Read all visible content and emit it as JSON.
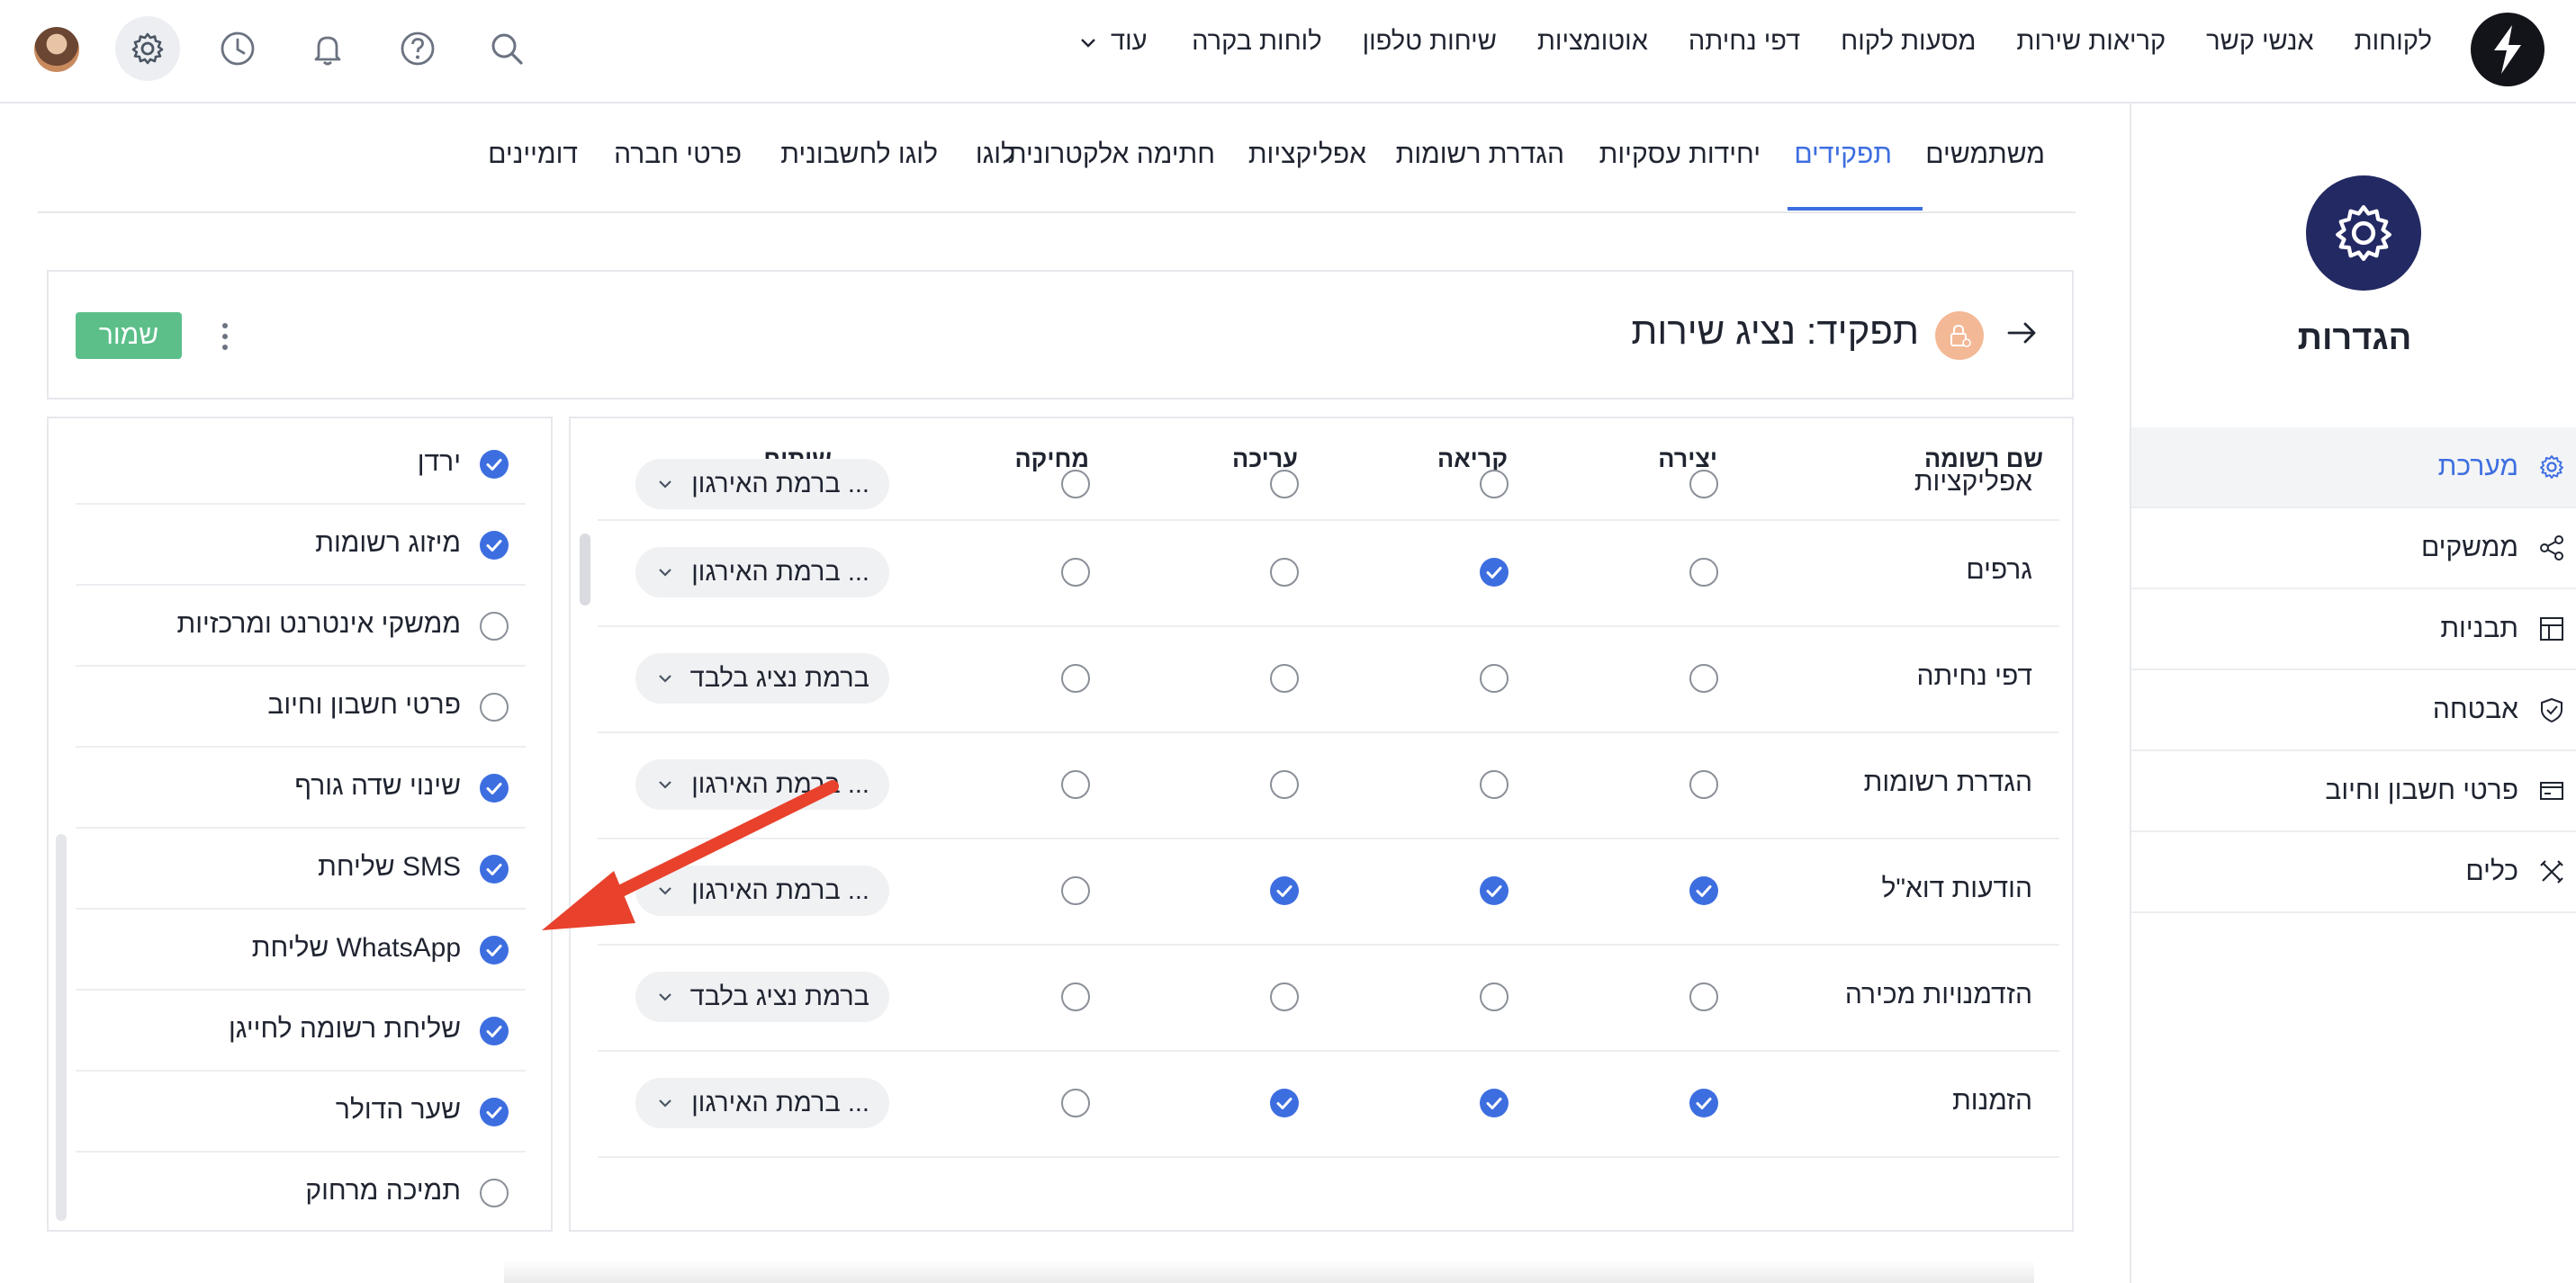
{
  "topbar": {
    "nav": [
      "לקוחות",
      "אנשי קשר",
      "קריאות שירות",
      "מסעות לקוח",
      "דפי נחיתה",
      "אוטומציות",
      "שיחות טלפון",
      "לוחות בקרה"
    ],
    "more_label": "עוד",
    "icons": [
      "search-icon",
      "help-icon",
      "bell-icon",
      "history-icon",
      "gear-icon",
      "avatar"
    ]
  },
  "sidebar": {
    "title": "הגדרות",
    "items": [
      {
        "label": "מערכת",
        "icon": "gear-icon",
        "active": true
      },
      {
        "label": "ממשקים",
        "icon": "share-icon",
        "active": false
      },
      {
        "label": "תבניות",
        "icon": "layout-icon",
        "active": false
      },
      {
        "label": "אבטחה",
        "icon": "shield-icon",
        "active": false
      },
      {
        "label": "פרטי חשבון וחיוב",
        "icon": "card-icon",
        "active": false
      },
      {
        "label": "כלים",
        "icon": "tools-icon",
        "active": false
      }
    ]
  },
  "tabs": [
    {
      "label": "משתמשים",
      "active": false
    },
    {
      "label": "תפקידים",
      "active": true
    },
    {
      "label": "יחידות עסקיות",
      "active": false
    },
    {
      "label": "הגדרת רשומות",
      "active": false
    },
    {
      "label": "אפליקציות",
      "active": false
    },
    {
      "label": "חתימה אלקטרונית",
      "active": false
    },
    {
      "label": "לוגו",
      "active": false
    },
    {
      "label": "לוגו לחשבונית",
      "active": false
    },
    {
      "label": "פרטי חברה",
      "active": false
    },
    {
      "label": "דומיינים",
      "active": false
    }
  ],
  "role": {
    "title": "תפקיד: נציג שירות",
    "save_label": "שמור"
  },
  "table": {
    "headers": [
      "שם רשומה",
      "יצירה",
      "קריאה",
      "עריכה",
      "מחיקה",
      "שיתוף"
    ],
    "rows": [
      {
        "name": "אפליקציות",
        "create": false,
        "read": false,
        "edit": false,
        "delete": false,
        "share": "ברמת האירגון ..."
      },
      {
        "name": "גרפים",
        "create": false,
        "read": true,
        "edit": false,
        "delete": false,
        "share": "ברמת האירגון ..."
      },
      {
        "name": "דפי נחיתה",
        "create": false,
        "read": false,
        "edit": false,
        "delete": false,
        "share": "ברמת נציג בלבד"
      },
      {
        "name": "הגדרת רשומות",
        "create": false,
        "read": false,
        "edit": false,
        "delete": false,
        "share": "ברמת האירגון ..."
      },
      {
        "name": "הודעות דוא\"ל",
        "create": true,
        "read": true,
        "edit": true,
        "delete": false,
        "share": "ברמת האירגון ..."
      },
      {
        "name": "הזדמנויות מכירה",
        "create": false,
        "read": false,
        "edit": false,
        "delete": false,
        "share": "ברמת נציג בלבד"
      },
      {
        "name": "הזמנות",
        "create": true,
        "read": true,
        "edit": true,
        "delete": false,
        "share": "ברמת האירגון ..."
      }
    ]
  },
  "permissions": [
    {
      "label": "ירדן",
      "checked": true
    },
    {
      "label": "מיזוג רשומות",
      "checked": true
    },
    {
      "label": "ממשקי אינטרנט ומרכזיות",
      "checked": false
    },
    {
      "label": "פרטי חשבון וחיוב",
      "checked": false
    },
    {
      "label": "שינוי שדה גורף",
      "checked": true
    },
    {
      "label": "שליחת SMS",
      "checked": true
    },
    {
      "label": "שליחת WhatsApp",
      "checked": true
    },
    {
      "label": "שליחת רשומה לחייגן",
      "checked": true
    },
    {
      "label": "שער הדולר",
      "checked": true
    },
    {
      "label": "תמיכה מרחוק",
      "checked": false
    }
  ],
  "colors": {
    "accent": "#3d6ee0",
    "save": "#5cbf8a",
    "annotation": "#e8412c",
    "settings_circle": "#232962",
    "role_badge": "#f3b896"
  }
}
